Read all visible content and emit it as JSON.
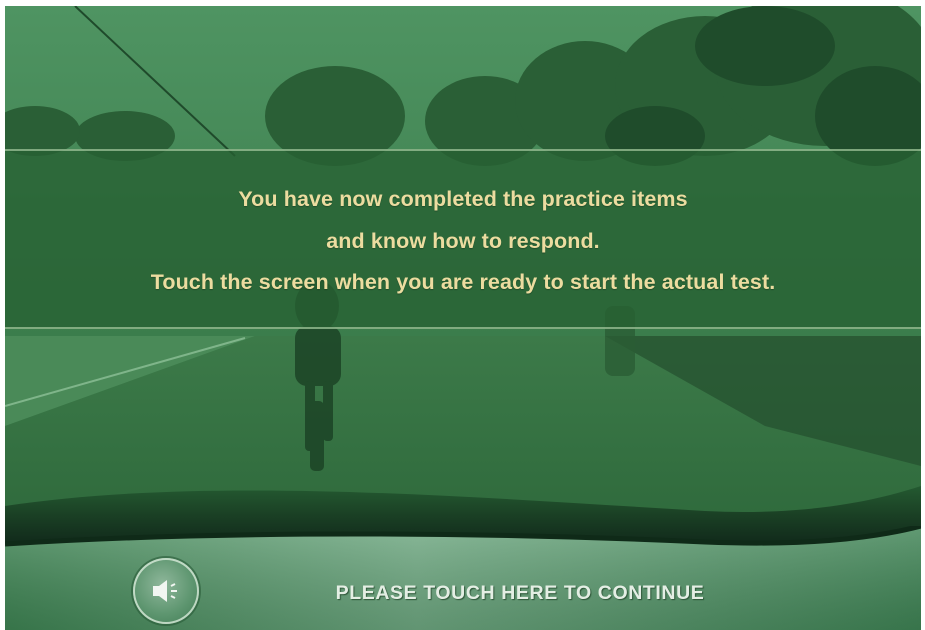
{
  "message": {
    "line1": "You have now completed the practice items",
    "line2": "and know how to respond.",
    "line3": "Touch the screen when you are ready to start the actual test."
  },
  "controls": {
    "continue_label": "PLEASE TOUCH HERE TO CONTINUE",
    "speaker_icon": "speaker-icon"
  },
  "colors": {
    "scene_tint": "#2f6b3c",
    "message_text": "#ecdca0",
    "control_text": "#e4eee4"
  }
}
